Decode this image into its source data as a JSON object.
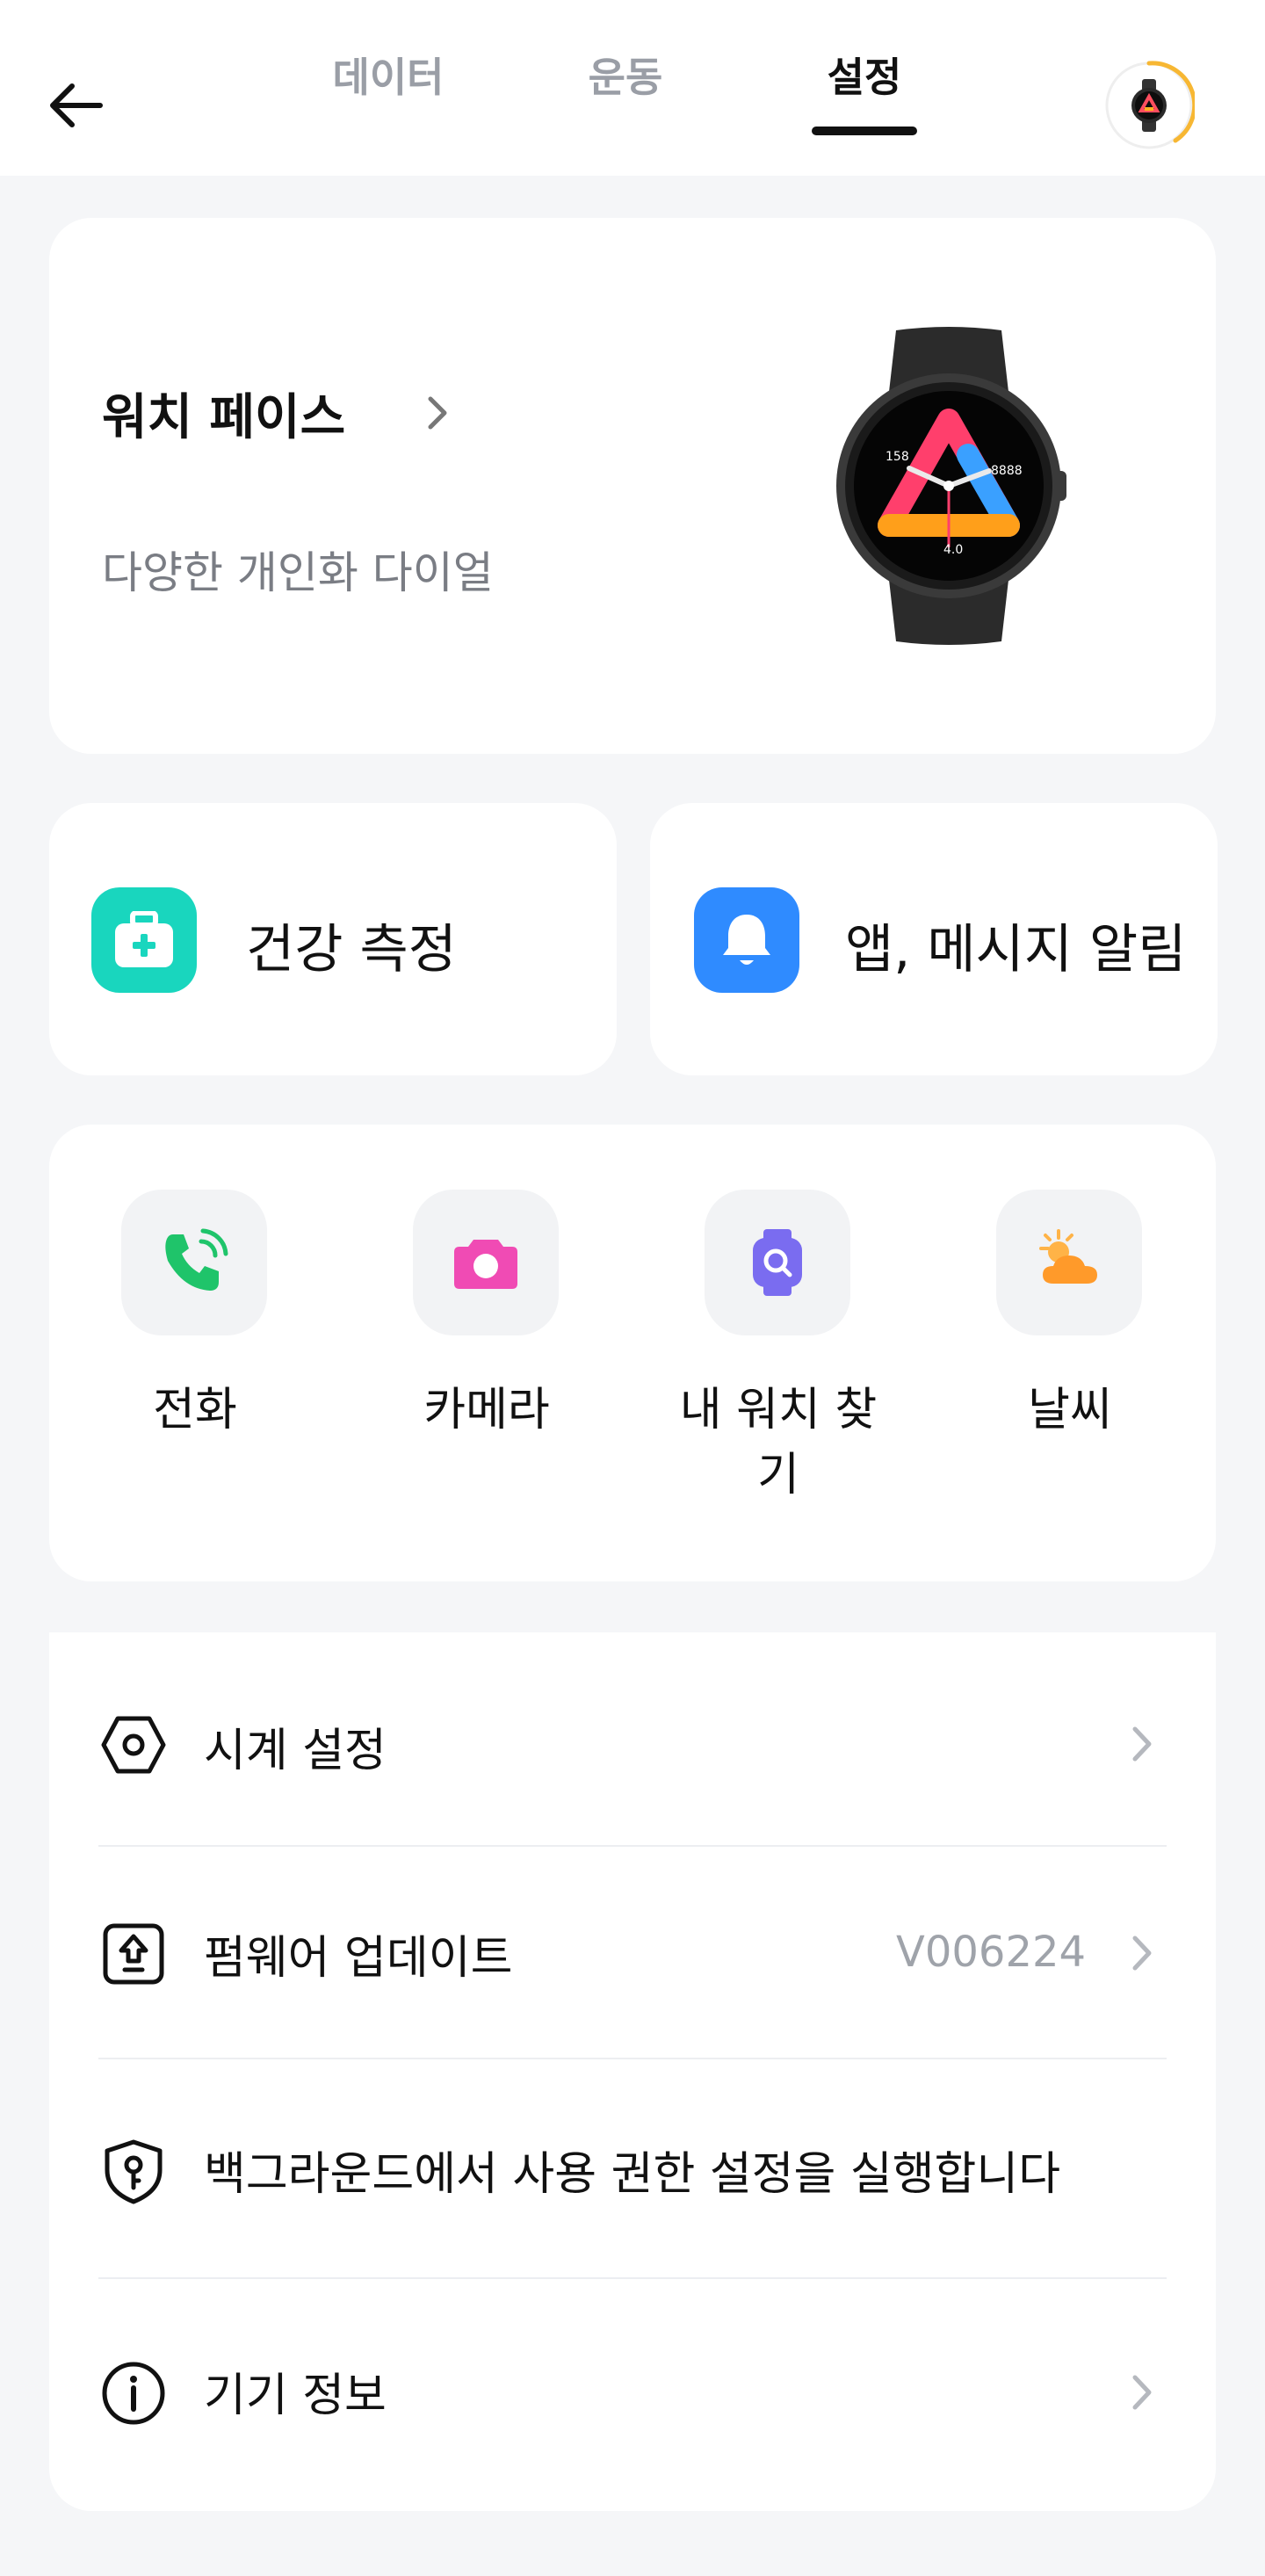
{
  "header": {
    "tabs": [
      {
        "label": "데이터",
        "active": false
      },
      {
        "label": "운동",
        "active": false
      },
      {
        "label": "설정",
        "active": true
      }
    ]
  },
  "watch_face_card": {
    "title": "워치 페이스",
    "subtitle": "다양한 개인화 다이얼",
    "preview_numbers": {
      "left": "158",
      "right": "8888",
      "bottom": "4.0"
    }
  },
  "tiles": [
    {
      "label": "건강 측정",
      "icon": "first-aid-kit-icon",
      "color": "#19d6be"
    },
    {
      "label": "앱, 메시지 알림",
      "icon": "bell-icon",
      "color": "#2f8bff"
    }
  ],
  "quick_actions": [
    {
      "label": "전화",
      "icon": "phone-icon"
    },
    {
      "label": "카메라",
      "icon": "camera-icon"
    },
    {
      "label": "내 워치 찾기",
      "icon": "find-watch-icon"
    },
    {
      "label": "날씨",
      "icon": "weather-icon"
    }
  ],
  "settings_list": [
    {
      "label": "시계 설정",
      "icon": "hexagon-nut-icon",
      "value": ""
    },
    {
      "label": "펌웨어 업데이트",
      "icon": "upload-icon",
      "value": "V006224"
    },
    {
      "label": "백그라운드에서 사용 권한 설정을 실행합니다",
      "icon": "shield-key-icon",
      "value": ""
    },
    {
      "label": "기기 정보",
      "icon": "info-icon",
      "value": ""
    }
  ],
  "colors": {
    "accent_teal": "#19d6be",
    "accent_blue": "#2f8bff",
    "phone_green": "#1fc46a",
    "camera_pink": "#f04bb4",
    "find_purple": "#7a6cf0",
    "weather_orange": "#ff9a2a",
    "avatar_ring": "#f7b733"
  }
}
